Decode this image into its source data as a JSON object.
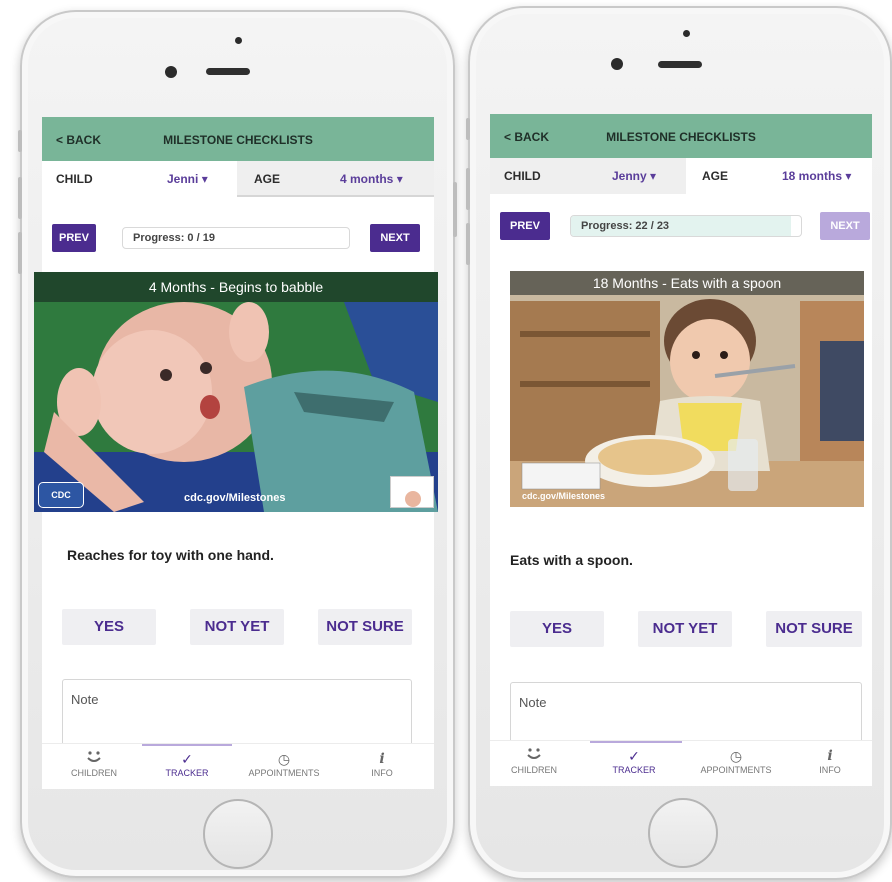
{
  "colors": {
    "header_green": "#79b598",
    "accent_purple": "#4b2c8f",
    "disabled_purple": "#b9a9dc",
    "progress_fill": "#e3f3ef"
  },
  "phones": [
    {
      "header": {
        "back_label": "< BACK",
        "title": "MILESTONE CHECKLISTS"
      },
      "selector": {
        "child_label": "CHILD",
        "child_value": "Jenni",
        "age_label": "AGE",
        "age_value": "4 months"
      },
      "nav": {
        "prev_label": "PREV",
        "next_label": "NEXT",
        "progress_text": "Progress: 0 / 19",
        "progress_fraction": 0.0,
        "next_enabled": true
      },
      "image": {
        "caption": "4 Months - Begins to babble",
        "site": "cdc.gov/Milestones",
        "badge_text": "CDC",
        "icon": "baby-photo"
      },
      "question": "Reaches for toy with one hand.",
      "answers": {
        "yes": "YES",
        "not_yet": "NOT YET",
        "not_sure": "NOT SURE"
      },
      "note_placeholder": "Note",
      "tabs": [
        {
          "label": "CHILDREN",
          "icon": "children-icon"
        },
        {
          "label": "TRACKER",
          "icon": "check-icon"
        },
        {
          "label": "APPOINTMENTS",
          "icon": "clock-icon"
        },
        {
          "label": "INFO",
          "icon": "info-icon"
        }
      ]
    },
    {
      "header": {
        "back_label": "< BACK",
        "title": "MILESTONE CHECKLISTS"
      },
      "selector": {
        "child_label": "CHILD",
        "child_value": "Jenny",
        "age_label": "AGE",
        "age_value": "18 months"
      },
      "nav": {
        "prev_label": "PREV",
        "next_label": "NEXT",
        "progress_text": "Progress: 22 / 23",
        "progress_fraction": 0.9565,
        "next_enabled": false
      },
      "image": {
        "caption": "18 Months - Eats with a spoon",
        "site": "cdc.gov/Milestones",
        "icon": "toddler-photo"
      },
      "question": "Eats with a spoon.",
      "answers": {
        "yes": "YES",
        "not_yet": "NOT YET",
        "not_sure": "NOT SURE"
      },
      "note_placeholder": "Note",
      "tabs": [
        {
          "label": "CHILDREN",
          "icon": "children-icon"
        },
        {
          "label": "TRACKER",
          "icon": "check-icon"
        },
        {
          "label": "APPOINTMENTS",
          "icon": "clock-icon"
        },
        {
          "label": "INFO",
          "icon": "info-icon"
        }
      ]
    }
  ]
}
